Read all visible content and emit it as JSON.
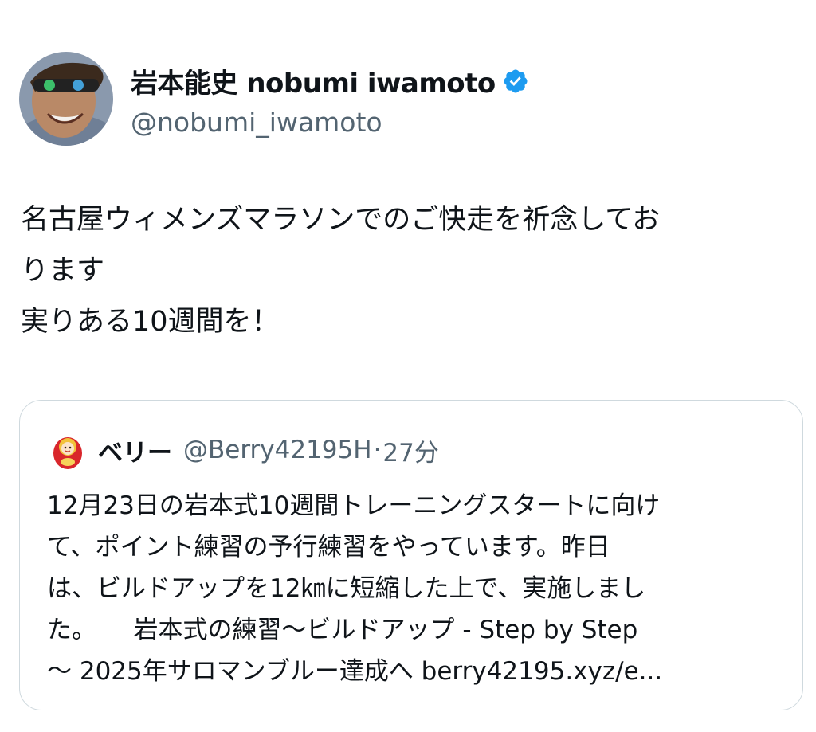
{
  "tweet": {
    "author": {
      "display_name": "岩本能史 nobumi iwamoto",
      "handle": "@nobumi_iwamoto",
      "verified_icon": "verified-badge-icon"
    },
    "body_lines": [
      "名古屋ウィメンズマラソンでのご快走を祈念してお",
      "ります",
      "実りある10週間を！"
    ]
  },
  "quoted_tweet": {
    "author_name": "ベリー",
    "handle": "@Berry42195H",
    "separator": "·",
    "time": "27分",
    "text_lines": [
      "12月23日の岩本式10週間トレーニングスタートに向け",
      "て、ポイント練習の予行練習をやっています。昨日",
      "は、ビルドアップを12㎞に短縮した上で、実施しまし",
      "た。　　岩本式の練習〜ビルドアップ - Step by Step",
      "〜 2025年サロマンブルー達成へ berry42195.xyz/e..."
    ]
  },
  "colors": {
    "text_primary": "#0f1419",
    "text_secondary": "#536471",
    "verified_blue": "#1d9bf0",
    "border": "#cfd9de"
  }
}
